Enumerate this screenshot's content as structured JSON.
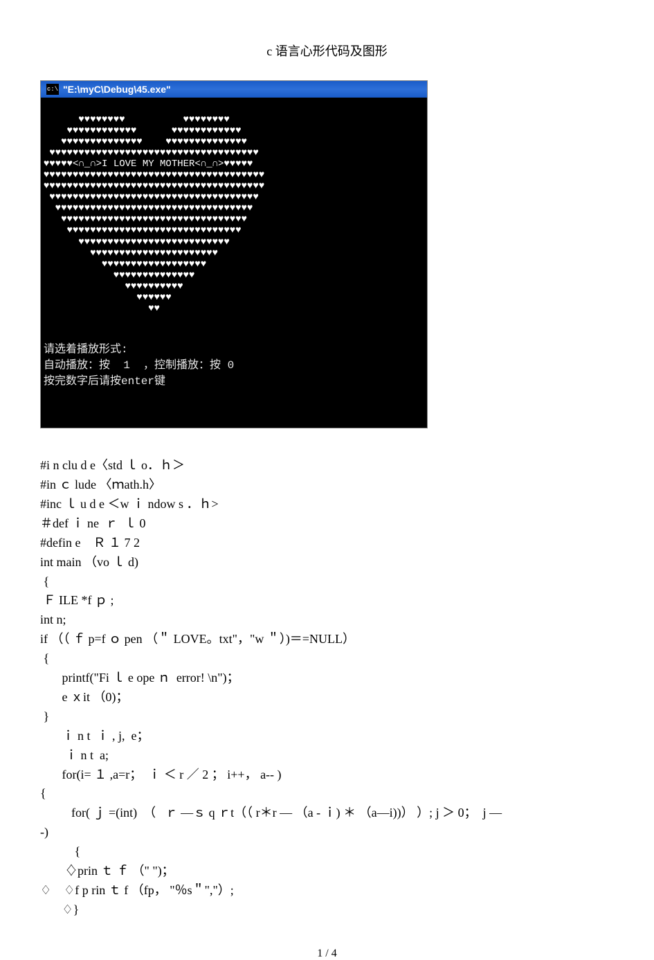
{
  "page_title": "c 语言心形代码及图形",
  "console": {
    "title_icon_text": "c:\\",
    "title_path": "\"E:\\myC\\Debug\\45.exe\"",
    "heart_lines": [
      "      ♥♥♥♥♥♥♥♥          ♥♥♥♥♥♥♥♥",
      "    ♥♥♥♥♥♥♥♥♥♥♥♥      ♥♥♥♥♥♥♥♥♥♥♥♥",
      "   ♥♥♥♥♥♥♥♥♥♥♥♥♥♥    ♥♥♥♥♥♥♥♥♥♥♥♥♥♥",
      " ♥♥♥♥♥♥♥♥♥♥♥♥♥♥♥♥♥♥♥♥♥♥♥♥♥♥♥♥♥♥♥♥♥♥♥♥",
      "♥♥♥♥♥<∩_∩>I LOVE MY MOTHER<∩_∩>♥♥♥♥♥",
      "♥♥♥♥♥♥♥♥♥♥♥♥♥♥♥♥♥♥♥♥♥♥♥♥♥♥♥♥♥♥♥♥♥♥♥♥♥♥",
      "♥♥♥♥♥♥♥♥♥♥♥♥♥♥♥♥♥♥♥♥♥♥♥♥♥♥♥♥♥♥♥♥♥♥♥♥♥♥",
      " ♥♥♥♥♥♥♥♥♥♥♥♥♥♥♥♥♥♥♥♥♥♥♥♥♥♥♥♥♥♥♥♥♥♥♥♥",
      "  ♥♥♥♥♥♥♥♥♥♥♥♥♥♥♥♥♥♥♥♥♥♥♥♥♥♥♥♥♥♥♥♥♥♥",
      "   ♥♥♥♥♥♥♥♥♥♥♥♥♥♥♥♥♥♥♥♥♥♥♥♥♥♥♥♥♥♥♥♥",
      "    ♥♥♥♥♥♥♥♥♥♥♥♥♥♥♥♥♥♥♥♥♥♥♥♥♥♥♥♥♥♥",
      "      ♥♥♥♥♥♥♥♥♥♥♥♥♥♥♥♥♥♥♥♥♥♥♥♥♥♥",
      "        ♥♥♥♥♥♥♥♥♥♥♥♥♥♥♥♥♥♥♥♥♥♥",
      "          ♥♥♥♥♥♥♥♥♥♥♥♥♥♥♥♥♥♥",
      "            ♥♥♥♥♥♥♥♥♥♥♥♥♥♥",
      "              ♥♥♥♥♥♥♥♥♥♥",
      "                ♥♥♥♥♥♥",
      "                  ♥♥"
    ],
    "prompt_line1": "请选着播放形式:",
    "prompt_line2": "自动播放：按  1  ，控制播放：按 0",
    "prompt_line3": "按完数字后请按enter键"
  },
  "code_lines": [
    "#i n clu d e〈std ｌ o．ｈ＞",
    "#in ｃ lude 〈ｍath.h〉",
    "#inc ｌ u d e ＜w ｉ ndow s ．ｈ>",
    "＃def ｉ ne  ｒ  ｌ 0",
    "#defin e    Ｒ １ 7 2",
    "int main （vo ｌ d)",
    " {",
    " Ｆ ILE *f ｐ ;",
    "int n;",
    "if （（ ｆ p=f ｏ pen （＂ LOVE。txt\"，\"w ＂）)＝=NULL）",
    " {",
    "       printf(\"Fi ｌ e ope ｎ  error! \\n\")；",
    "       e ｘit （0)；",
    " }",
    "       ｉ n t  ｉ , j,  e；",
    "        ｉ n t  a;",
    "       for(i= １ ,a=r；  ｉ ＜ r ／ 2 ； i++， a-- )",
    "{",
    "          for( ｊ =(int)  （   ｒ —ｓ q ｒt（（ r＊r — （a - ｉ) ＊ （a—i))） ）; j ＞ 0；  j —",
    "-)",
    "           {",
    "        ♢prin ｔ ｆ （\" \")；",
    "♢    ♢f p rin ｔ f （fp， \"％s＂\",\"）;",
    "       ♢}"
  ],
  "page_number": "1 / 4"
}
